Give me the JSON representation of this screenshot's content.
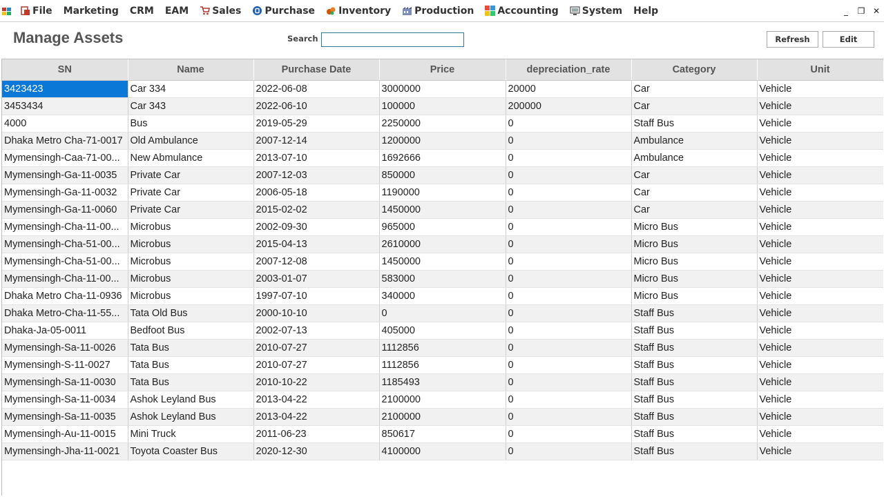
{
  "menubar": {
    "items": [
      {
        "label": "File",
        "icon": "file-icon"
      },
      {
        "label": "Marketing",
        "icon": ""
      },
      {
        "label": "CRM",
        "icon": ""
      },
      {
        "label": "EAM",
        "icon": ""
      },
      {
        "label": "Sales",
        "icon": "cart-icon"
      },
      {
        "label": "Purchase",
        "icon": "purchase-icon"
      },
      {
        "label": "Inventory",
        "icon": "inventory-icon"
      },
      {
        "label": "Production",
        "icon": "production-icon"
      },
      {
        "label": "Accounting",
        "icon": "accounting-icon"
      },
      {
        "label": "System",
        "icon": "system-icon"
      },
      {
        "label": "Help",
        "icon": ""
      }
    ],
    "window_controls": {
      "minimize": "_",
      "restore": "❐",
      "close": "✕"
    }
  },
  "header": {
    "title": "Manage Assets",
    "search_label": "Search",
    "search_value": "",
    "refresh_label": "Refresh",
    "edit_label": "Edit"
  },
  "colors": {
    "selection": "#0a78d7",
    "header_bg": "#e2e2e2",
    "row_alt": "#f1f1f1"
  },
  "table": {
    "columns": [
      "SN",
      "Name",
      "Purchase Date",
      "Price",
      "depreciation_rate",
      "Category",
      "Unit"
    ],
    "selected_row": 0,
    "rows": [
      [
        "3423423",
        "Car 334",
        "2022-06-08",
        "3000000",
        "20000",
        "Car",
        "Vehicle"
      ],
      [
        "3453434",
        "Car 343",
        "2022-06-10",
        "100000",
        "200000",
        "Car",
        "Vehicle"
      ],
      [
        "4000",
        "Bus",
        "2019-05-29",
        "2250000",
        "0",
        "Staff Bus",
        "Vehicle"
      ],
      [
        "Dhaka Metro Cha-71-0017",
        "Old Ambulance",
        "2007-12-14",
        "1200000",
        "0",
        "Ambulance",
        "Vehicle"
      ],
      [
        "Mymensingh-Caa-71-00...",
        "New Abmulance",
        "2013-07-10",
        "1692666",
        "0",
        "Ambulance",
        "Vehicle"
      ],
      [
        "Mymensingh-Ga-11-0035",
        "Private Car",
        "2007-12-03",
        "850000",
        "0",
        "Car",
        "Vehicle"
      ],
      [
        "Mymensingh-Ga-11-0032",
        "Private Car",
        "2006-05-18",
        "1190000",
        "0",
        "Car",
        "Vehicle"
      ],
      [
        "Mymensingh-Ga-11-0060",
        "Private Car",
        "2015-02-02",
        "1450000",
        "0",
        "Car",
        "Vehicle"
      ],
      [
        "Mymensingh-Cha-11-00...",
        "Microbus",
        "2002-09-30",
        "965000",
        "0",
        "Micro Bus",
        "Vehicle"
      ],
      [
        "Mymensingh-Cha-51-00...",
        "Microbus",
        "2015-04-13",
        "2610000",
        "0",
        "Micro Bus",
        "Vehicle"
      ],
      [
        "Mymensingh-Cha-51-00...",
        "Microbus",
        "2007-12-08",
        "1450000",
        "0",
        "Micro Bus",
        "Vehicle"
      ],
      [
        "Mymensingh-Cha-11-00...",
        "Microbus",
        "2003-01-07",
        "583000",
        "0",
        "Micro Bus",
        "Vehicle"
      ],
      [
        "Dhaka Metro Cha-11-0936",
        "Microbus",
        "1997-07-10",
        "340000",
        "0",
        "Micro Bus",
        "Vehicle"
      ],
      [
        "Dhaka Metro-Cha-11-55...",
        "Tata Old Bus",
        "2000-10-10",
        "0",
        "0",
        "Staff Bus",
        "Vehicle"
      ],
      [
        "Dhaka-Ja-05-0011",
        "Bedfoot Bus",
        "2002-07-13",
        "405000",
        "0",
        "Staff Bus",
        "Vehicle"
      ],
      [
        "Mymensingh-Sa-11-0026",
        "Tata Bus",
        "2010-07-27",
        "1112856",
        "0",
        "Staff Bus",
        "Vehicle"
      ],
      [
        "Mymensingh-S-11-0027",
        "Tata Bus",
        "2010-07-27",
        "1112856",
        "0",
        "Staff Bus",
        "Vehicle"
      ],
      [
        "Mymensingh-Sa-11-0030",
        "Tata Bus",
        "2010-10-22",
        "1185493",
        "0",
        "Staff Bus",
        "Vehicle"
      ],
      [
        "Mymensingh-Sa-11-0034",
        "Ashok Leyland Bus",
        "2013-04-22",
        "2100000",
        "0",
        "Staff Bus",
        "Vehicle"
      ],
      [
        "Mymensingh-Sa-11-0035",
        "Ashok Leyland Bus",
        "2013-04-22",
        "2100000",
        "0",
        "Staff Bus",
        "Vehicle"
      ],
      [
        "Mymensingh-Au-11-0015",
        "Mini Truck",
        "2011-06-23",
        "850617",
        "0",
        "Staff Bus",
        "Vehicle"
      ],
      [
        "Mymensingh-Jha-11-0021",
        "Toyota Coaster Bus",
        "2020-12-30",
        "4100000",
        "0",
        "Staff Bus",
        "Vehicle"
      ]
    ]
  }
}
